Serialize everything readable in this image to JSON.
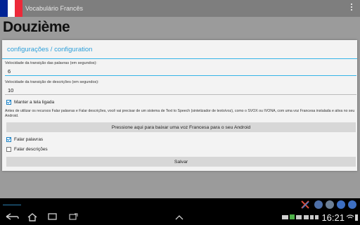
{
  "app": {
    "title": "Vocabulário Francês",
    "flag_colors": [
      "#002395",
      "#ffffff",
      "#ed2939"
    ]
  },
  "page": {
    "heading": "Douzième"
  },
  "dialog": {
    "title": "configurações / configuration",
    "words_speed": {
      "label": "Velocidade da transição das palavras (em segundos):",
      "value": "6"
    },
    "desc_speed": {
      "label": "Velocidade da transição de descrições (em segundos):",
      "value": "10"
    },
    "keep_screen_on": {
      "label": "Manter a tela ligada",
      "checked": true
    },
    "info": "Antes de utilizar os recursos Falar palavras e Falar descrições, você vai precisar de um sistema de Text to Speech (sintetizador de texto/voz), como o SVOX ou IVONA, com uma voz Francesa instalada e ativa no seu Android.",
    "download_button": "Pressione aqui para baixar uma voz Francesa para o seu Android",
    "speak_words": {
      "label": "Falar palavras",
      "checked": true
    },
    "speak_descriptions": {
      "label": "Falar descrições",
      "checked": false
    },
    "save_button": "Salvar"
  },
  "status": {
    "time": "16:21"
  },
  "colors": {
    "accent": "#33b5e5",
    "dialog_bg": "#f3f3f3",
    "button_bg": "#d7d7d7"
  }
}
